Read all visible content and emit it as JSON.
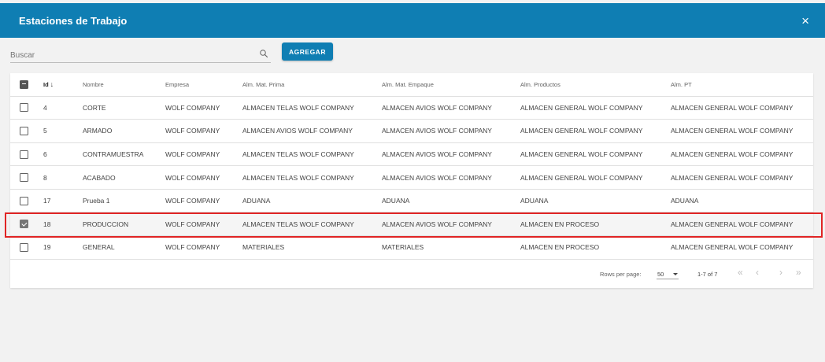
{
  "dialog": {
    "title": "Estaciones de Trabajo",
    "close_icon": "×"
  },
  "toolbar": {
    "search_placeholder": "Buscar",
    "search_value": "",
    "add_label": "AGREGAR"
  },
  "table": {
    "columns": {
      "id": "Id",
      "nombre": "Nombre",
      "empresa": "Empresa",
      "mat_prima": "Alm. Mat. Prima",
      "mat_empaque": "Alm. Mat. Empaque",
      "productos": "Alm. Productos",
      "pt": "Alm. PT"
    },
    "sort_indicator": "↓",
    "header_checkbox_state": "indeterminate",
    "rows": [
      {
        "checked": false,
        "id": "4",
        "nombre": "CORTE",
        "empresa": "WOLF COMPANY",
        "mat_prima": "ALMACEN TELAS WOLF COMPANY",
        "mat_empaque": "ALMACEN AVIOS WOLF COMPANY",
        "productos": "ALMACEN GENERAL WOLF COMPANY",
        "pt": "ALMACEN GENERAL WOLF COMPANY"
      },
      {
        "checked": false,
        "id": "5",
        "nombre": "ARMADO",
        "empresa": "WOLF COMPANY",
        "mat_prima": "ALMACEN AVIOS WOLF COMPANY",
        "mat_empaque": "ALMACEN AVIOS WOLF COMPANY",
        "productos": "ALMACEN GENERAL WOLF COMPANY",
        "pt": "ALMACEN GENERAL WOLF COMPANY"
      },
      {
        "checked": false,
        "id": "6",
        "nombre": "CONTRAMUESTRA",
        "empresa": "WOLF COMPANY",
        "mat_prima": "ALMACEN TELAS WOLF COMPANY",
        "mat_empaque": "ALMACEN AVIOS WOLF COMPANY",
        "productos": "ALMACEN GENERAL WOLF COMPANY",
        "pt": "ALMACEN GENERAL WOLF COMPANY"
      },
      {
        "checked": false,
        "id": "8",
        "nombre": "ACABADO",
        "empresa": "WOLF COMPANY",
        "mat_prima": "ALMACEN TELAS WOLF COMPANY",
        "mat_empaque": "ALMACEN AVIOS WOLF COMPANY",
        "productos": "ALMACEN GENERAL WOLF COMPANY",
        "pt": "ALMACEN GENERAL WOLF COMPANY"
      },
      {
        "checked": false,
        "id": "17",
        "nombre": "Prueba 1",
        "empresa": "WOLF COMPANY",
        "mat_prima": "ADUANA",
        "mat_empaque": "ADUANA",
        "productos": "ADUANA",
        "pt": "ADUANA"
      },
      {
        "checked": true,
        "id": "18",
        "nombre": "PRODUCCION",
        "empresa": "WOLF COMPANY",
        "mat_prima": "ALMACEN TELAS WOLF COMPANY",
        "mat_empaque": "ALMACEN AVIOS WOLF COMPANY",
        "productos": "ALMACEN EN PROCESO",
        "pt": "ALMACEN GENERAL WOLF COMPANY"
      },
      {
        "checked": false,
        "id": "19",
        "nombre": "GENERAL",
        "empresa": "WOLF COMPANY",
        "mat_prima": "MATERIALES",
        "mat_empaque": "MATERIALES",
        "productos": "ALMACEN EN PROCESO",
        "pt": "ALMACEN GENERAL WOLF COMPANY"
      }
    ]
  },
  "pagination": {
    "rows_per_page_label": "Rows per page:",
    "rows_per_page_value": "50",
    "range_label": "1-7 of 7",
    "first_icon": "«",
    "prev_icon": "‹",
    "next_icon": "›",
    "last_icon": "»"
  },
  "colors": {
    "header_blue": "#0f7eb3",
    "highlight_red": "#e02424"
  }
}
